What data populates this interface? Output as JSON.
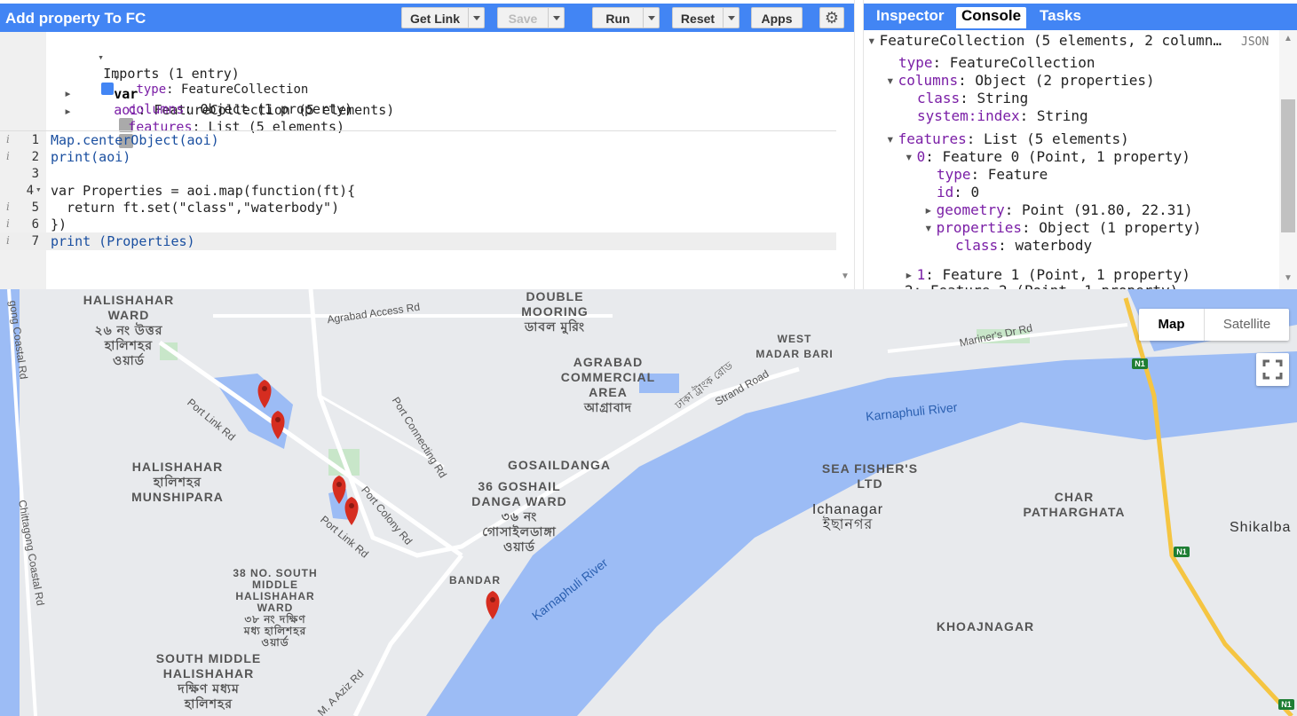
{
  "app": {
    "title": "Add property To FC",
    "buttons": {
      "get_link": "Get Link",
      "save": "Save",
      "run": "Run",
      "reset": "Reset",
      "apps": "Apps"
    }
  },
  "editor": {
    "imports_header": "Imports (1 entry)",
    "import_var": {
      "keyword": "var",
      "name": "aoi",
      "desc": ": FeatureCollection (5 elements)",
      "type_key": "type",
      "type_val": ": FeatureCollection",
      "columns_key": "columns",
      "columns_val": ": Object (1 property)",
      "features_key": "features",
      "features_val": ": List (5 elements)"
    },
    "lines": [
      {
        "num": "1",
        "text": "Map.centerObject(aoi)"
      },
      {
        "num": "2",
        "text": "print(aoi)"
      },
      {
        "num": "3",
        "text": ""
      },
      {
        "num": "4",
        "text": "var Properties = aoi.map(function(ft){"
      },
      {
        "num": "5",
        "text": "  return ft.set(\"class\",\"waterbody\")"
      },
      {
        "num": "6",
        "text": "})"
      },
      {
        "num": "7",
        "text": "print (Properties)"
      }
    ]
  },
  "panel": {
    "tabs": [
      "Inspector",
      "Console",
      "Tasks"
    ],
    "active_tab": "Console",
    "json_label": "JSON",
    "tree": {
      "root": "FeatureCollection (5 elements, 2 column…",
      "type_key": "type",
      "type_val": ": FeatureCollection",
      "columns_key": "columns",
      "columns_val": ": Object (2 properties)",
      "class_key": "class",
      "class_val": ": String",
      "sysidx_key": "system:index",
      "sysidx_val": ": String",
      "features_key": "features",
      "features_val": ": List (5 elements)",
      "f0_key": "0",
      "f0_val": ": Feature 0 (Point, 1 property)",
      "f0_type_key": "type",
      "f0_type_val": ": Feature",
      "f0_id_key": "id",
      "f0_id_val": ": 0",
      "f0_geom_key": "geometry",
      "f0_geom_val": ": Point (91.80, 22.31)",
      "f0_props_key": "properties",
      "f0_props_val": ": Object (1 property)",
      "f0_class_key": "class",
      "f0_class_val": ": waterbody",
      "f1_key": "1",
      "f1_val": ": Feature 1 (Point, 1 property)",
      "f2_partial": "2: Feature 2 (Point, 1 property)"
    }
  },
  "map": {
    "toggle": {
      "map": "Map",
      "satellite": "Satellite"
    },
    "labels": {
      "halishahar_ward": "HALISHAHAR\nWARD\n২৬ নং উত্তর\nহালিশহর\nওয়ার্ড",
      "double_mooring": "DOUBLE\nMOORING\nডাবল মুরিং",
      "west_madar_bari": "WEST\nMADAR BARI",
      "agrabad": "AGRABAD\nCOMMERCIAL\nAREA\nআগ্রাবাদ",
      "halishahar_munshipara": "HALISHAHAR\nহালিশহর\nMUNSHIPARA",
      "gosaildanga": "GOSAILDANGA",
      "goshail_danga_ward": "36 GOSHAIL\nDANGA WARD\n৩৬ নং\nগোসাইলডাঙ্গা\nওয়ার্ড",
      "sea_fishers": "SEA FISHER'S\nLTD",
      "ichanagar": "Ichanagar\nইছানগর",
      "char_patharghata": "CHAR\nPATHARGHATA",
      "shikalba": "Shikalba",
      "south_middle_38": "38 NO. SOUTH\nMIDDLE\nHALISHAHAR\nWARD\n৩৮ নং দক্ষিণ\nমধ্য হালিশহর\nওয়ার্ড",
      "bandar": "BANDAR",
      "south_middle": "SOUTH MIDDLE\nHALISHAHAR\nদক্ষিণ মধ্যম\nহালিশহর",
      "khoajnagar": "KHOAJNAGAR"
    },
    "roads": {
      "agrabad_access": "Agrabad Access Rd",
      "mariners": "Mariner's Dr Rd",
      "strand": "Strand Road",
      "dhaka_trunk": "ঢাকা ট্রাংক রোড",
      "port_connecting": "Port Connecting Rd",
      "port_link_1": "Port Link Rd",
      "port_link_2": "Port Link Rd",
      "port_colony": "Port Colony Rd",
      "coastal_1": "gong Coastal Rd",
      "coastal_2": "Chittagong Coastal Rd",
      "ma_aziz": "M. A Aziz Rd"
    },
    "rivers": {
      "r1": "Karnaphuli River",
      "r2": "Karnaphuli River"
    },
    "highway": "N1"
  },
  "colors": {
    "accent": "#4285f4",
    "water": "#9cbcf5",
    "map_bg": "#e8eaed",
    "marker": "#d62d20",
    "highway": "#f5c542"
  }
}
